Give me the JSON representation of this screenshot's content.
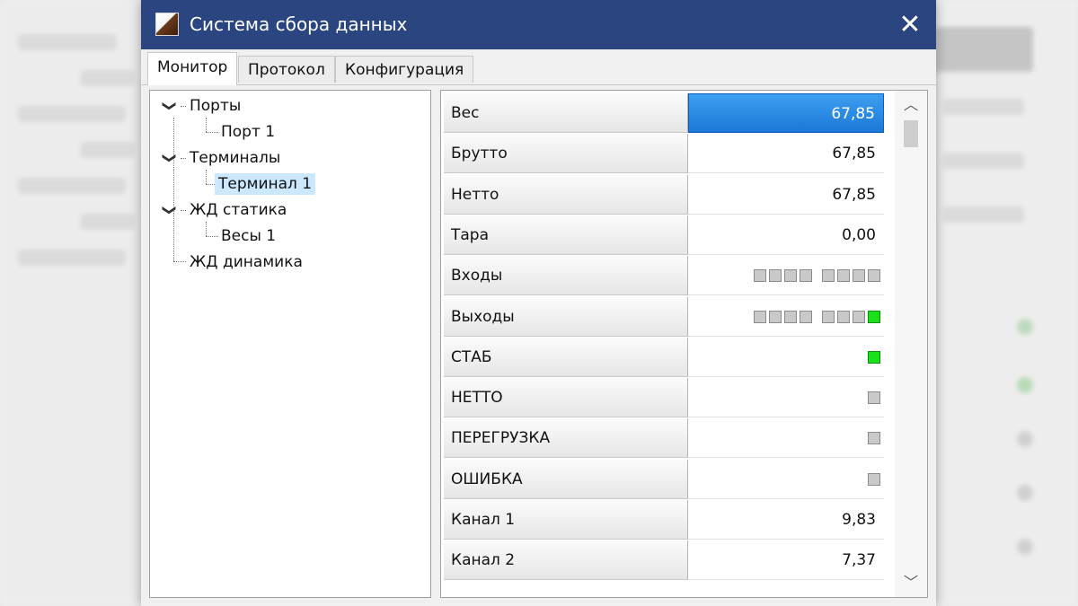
{
  "window": {
    "title": "Система сбора данных"
  },
  "tabs": [
    {
      "label": "Монитор",
      "active": true
    },
    {
      "label": "Протокол",
      "active": false
    },
    {
      "label": "Конфигурация",
      "active": false
    }
  ],
  "tree": {
    "ports": "Порты",
    "port1": "Порт 1",
    "terminals": "Терминалы",
    "terminal1": "Терминал 1",
    "rail_static": "ЖД статика",
    "scales1": "Весы 1",
    "rail_dynamic": "ЖД динамика",
    "selected": "Терминал 1"
  },
  "grid": {
    "rows": [
      {
        "label": "Вес",
        "value": "67,85",
        "selected": true
      },
      {
        "label": "Брутто",
        "value": "67,85"
      },
      {
        "label": "Нетто",
        "value": "67,85"
      },
      {
        "label": "Тара",
        "value": "0,00"
      },
      {
        "label": "Входы",
        "leds": [
          0,
          0,
          0,
          0,
          0,
          0,
          0,
          0
        ]
      },
      {
        "label": "Выходы",
        "leds": [
          0,
          0,
          0,
          0,
          0,
          0,
          0,
          1
        ]
      },
      {
        "label": "СТАБ",
        "leds": [
          1
        ]
      },
      {
        "label": "НЕТТО",
        "leds": [
          0
        ]
      },
      {
        "label": "ПЕРЕГРУЗКА",
        "leds": [
          0
        ]
      },
      {
        "label": "ОШИБКА",
        "leds": [
          0
        ]
      },
      {
        "label": "Канал 1",
        "value": "9,83"
      },
      {
        "label": "Канал 2",
        "value": "7,37"
      }
    ]
  },
  "colors": {
    "titlebar": "#2b4580",
    "selection": "#1b78d6",
    "led_on": "#19e019",
    "led_off": "#c9c9c9"
  }
}
